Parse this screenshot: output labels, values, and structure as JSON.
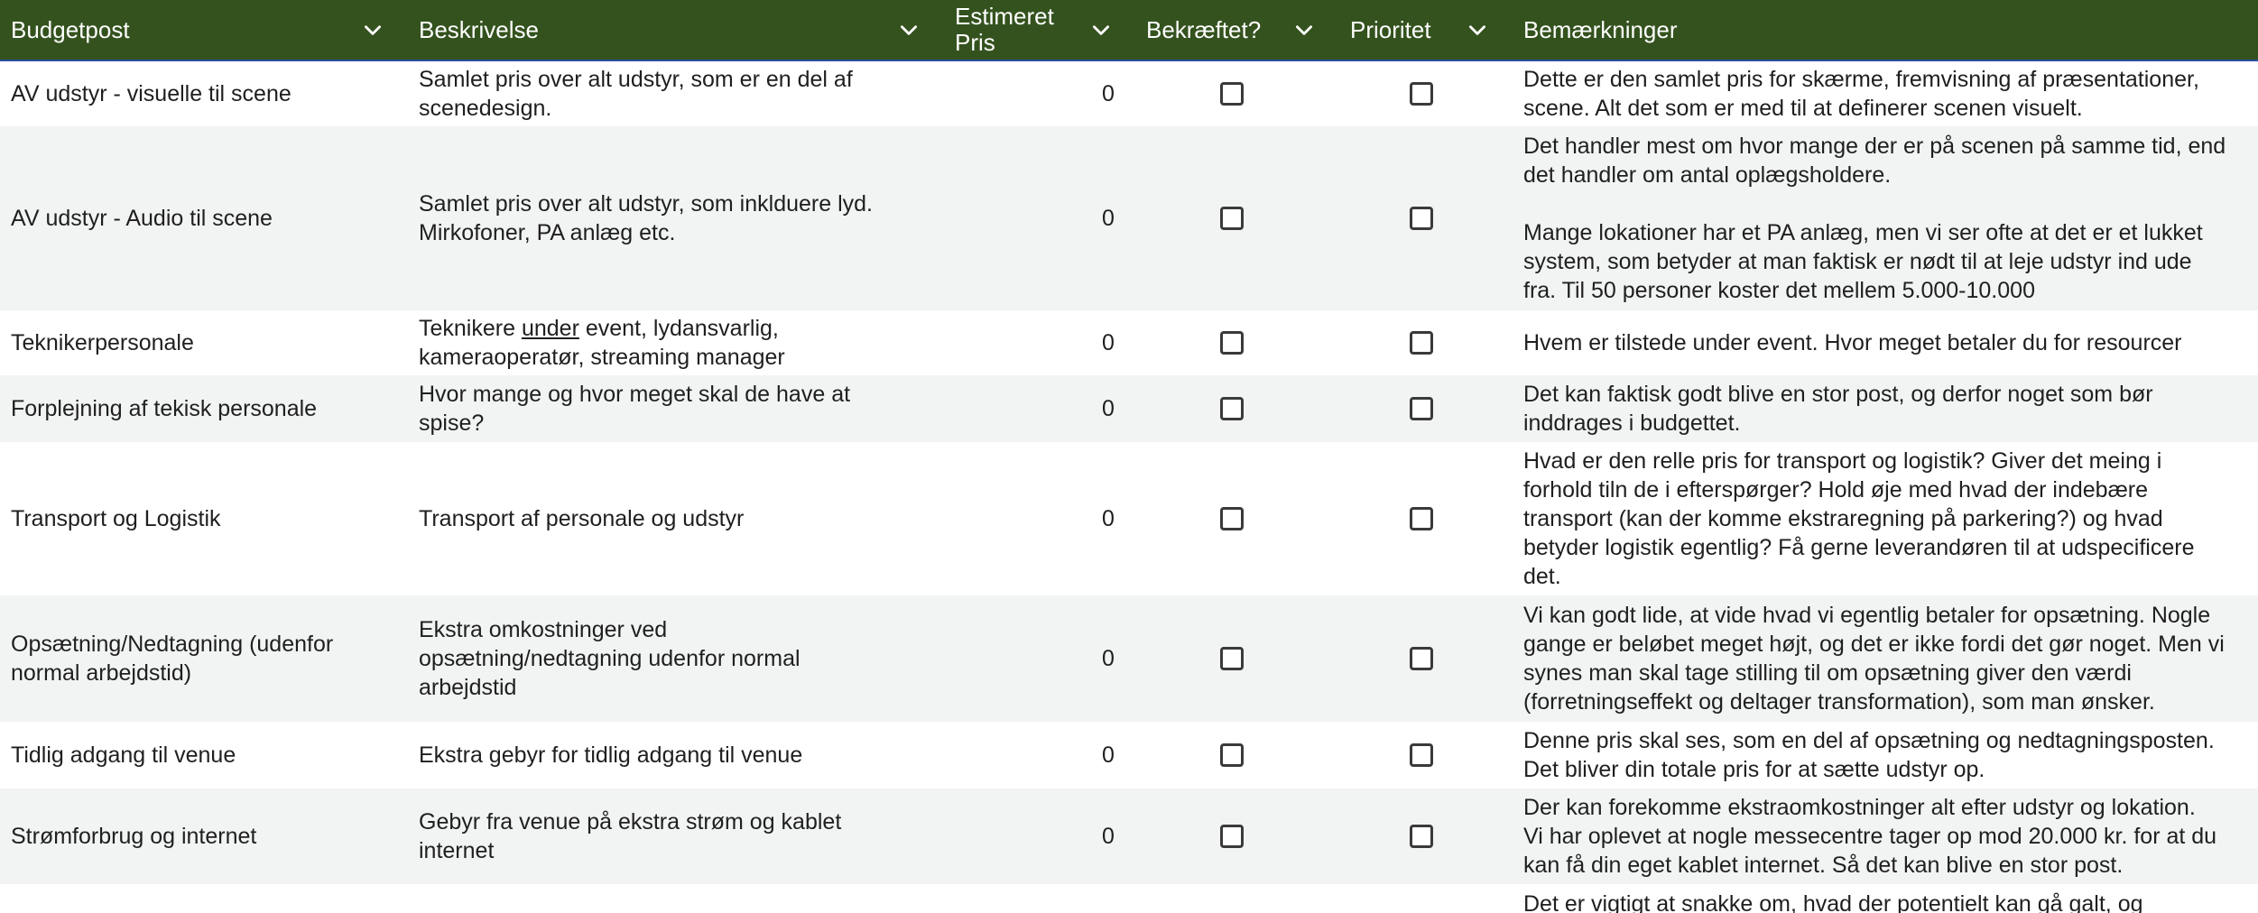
{
  "colors": {
    "header_bg": "#34521e",
    "header_text": "#ffffff",
    "row_alt": "#f2f3f3"
  },
  "columns": [
    {
      "key": "budgetpost",
      "label": "Budgetpost",
      "icon": "chevron-down-icon"
    },
    {
      "key": "beskrivelse",
      "label": "Beskrivelse",
      "icon": "chevron-down-icon"
    },
    {
      "key": "estimeret_pris",
      "label": "Estimeret\nPris",
      "icon": "chevron-down-icon"
    },
    {
      "key": "bekraeftet",
      "label": "Bekræftet?",
      "icon": "chevron-down-icon"
    },
    {
      "key": "prioritet",
      "label": "Prioritet",
      "icon": "chevron-down-icon"
    },
    {
      "key": "bemaerkninger",
      "label": "Bemærkninger",
      "icon": "chevron-down-icon"
    }
  ],
  "rows": [
    {
      "budgetpost": "AV udstyr - visuelle til scene",
      "beskrivelse": "Samlet pris over alt udstyr, som er en del af\nscenedesign.",
      "estimeret_pris": "0",
      "bekraeftet": false,
      "prioritet": false,
      "bemaerkninger": "Dette er den samlet pris for skærme, fremvisning af præsentationer,\nscene. Alt det som er med til at definerer scenen visuelt."
    },
    {
      "budgetpost": "AV udstyr - Audio til scene",
      "beskrivelse": "Samlet pris over alt udstyr, som inkl­duere lyd.\nMirkofoner, PA anlæg etc.",
      "estimeret_pris": "0",
      "bekraeftet": false,
      "prioritet": false,
      "bemaerkninger": "Det handler mest om hvor mange der er på scenen på samme tid, end\ndet handler om antal oplægsholdere.\n\nMange lokationer har et PA anlæg, men vi ser ofte at det er et lukket\nsystem, som betyder at man faktisk er nødt til at leje udstyr ind ude\nfra. Til 50 personer koster det mellem 5.000-10.000"
    },
    {
      "budgetpost": "Teknikerpersonale",
      "beskrivelse_pre": "Teknikere ",
      "beskrivelse_underlined": "under",
      "beskrivelse_post": " event, lydansvarlig,\nkameraoperatør, streaming manager",
      "estimeret_pris": "0",
      "bekraeftet": false,
      "prioritet": false,
      "bemaerkninger": "Hvem er tilstede under event. Hvor meget betaler du for resourcer"
    },
    {
      "budgetpost": "Forplejning af tekisk personale",
      "beskrivelse": "Hvor mange og hvor meget skal de have at\nspise?",
      "estimeret_pris": "0",
      "bekraeftet": false,
      "prioritet": false,
      "bemaerkninger": "Det kan faktisk godt blive en stor post, og derfor noget som bør\ninddrages i budgettet."
    },
    {
      "budgetpost": "Transport og Logistik",
      "beskrivelse": "Transport af personale og udstyr",
      "estimeret_pris": "0",
      "bekraeftet": false,
      "prioritet": false,
      "bemaerkninger": "Hvad er den relle pris for transport og logistik? Giver det meing i\nforhold tiln de i efterspørger? Hold øje med hvad der indebære\ntransport (kan der komme ekstraregning på parkering?) og hvad\nbetyder logistik egentlig? Få gerne leverandøren til at udspecificere\ndet."
    },
    {
      "budgetpost": "Opsætning/Nedtagning (udenfor\nnormal arbejdstid)",
      "beskrivelse": "Ekstra omkostninger ved\nopsætning/nedtagning udenfor normal\narbejdstid",
      "estimeret_pris": "0",
      "bekraeftet": false,
      "prioritet": false,
      "bemaerkninger": "Vi kan godt lide, at vide hvad vi egentlig betaler for opsætning. Nogle\ngange er beløbet meget højt, og det er ikke fordi det gør noget. Men vi\nsynes man skal tage stilling til om opsætning giver den værdi\n(forretningseffekt og deltager transformation), som man ønsker."
    },
    {
      "budgetpost": "Tidlig adgang til venue",
      "beskrivelse": "Ekstra gebyr for tidlig adgang til venue",
      "estimeret_pris": "0",
      "bekraeftet": false,
      "prioritet": false,
      "bemaerkninger": "Denne pris skal ses, som en del af opsætning og nedtagningsposten.\nDet bliver din totale pris for at sætte udstyr op."
    },
    {
      "budgetpost": "Strømforbrug og internet",
      "beskrivelse": "Gebyr fra venue på ekstra strøm og kablet\ninternet",
      "estimeret_pris": "0",
      "bekraeftet": false,
      "prioritet": false,
      "bemaerkninger": "Der kan forekomme ekstraomkostninger alt efter udstyr og lokation.\nVi har oplevet at nogle messecentre tager op mod 20.000 kr. for at du\nkan få din eget kablet internet. Så det kan blive en stor post."
    },
    {
      "budgetpost": "",
      "beskrivelse": "",
      "estimeret_pris": "",
      "bekraeftet": null,
      "prioritet": null,
      "bemaerkninger": "Det er vigtigt at snakke om, hvad der potentielt kan gå galt, og"
    }
  ]
}
